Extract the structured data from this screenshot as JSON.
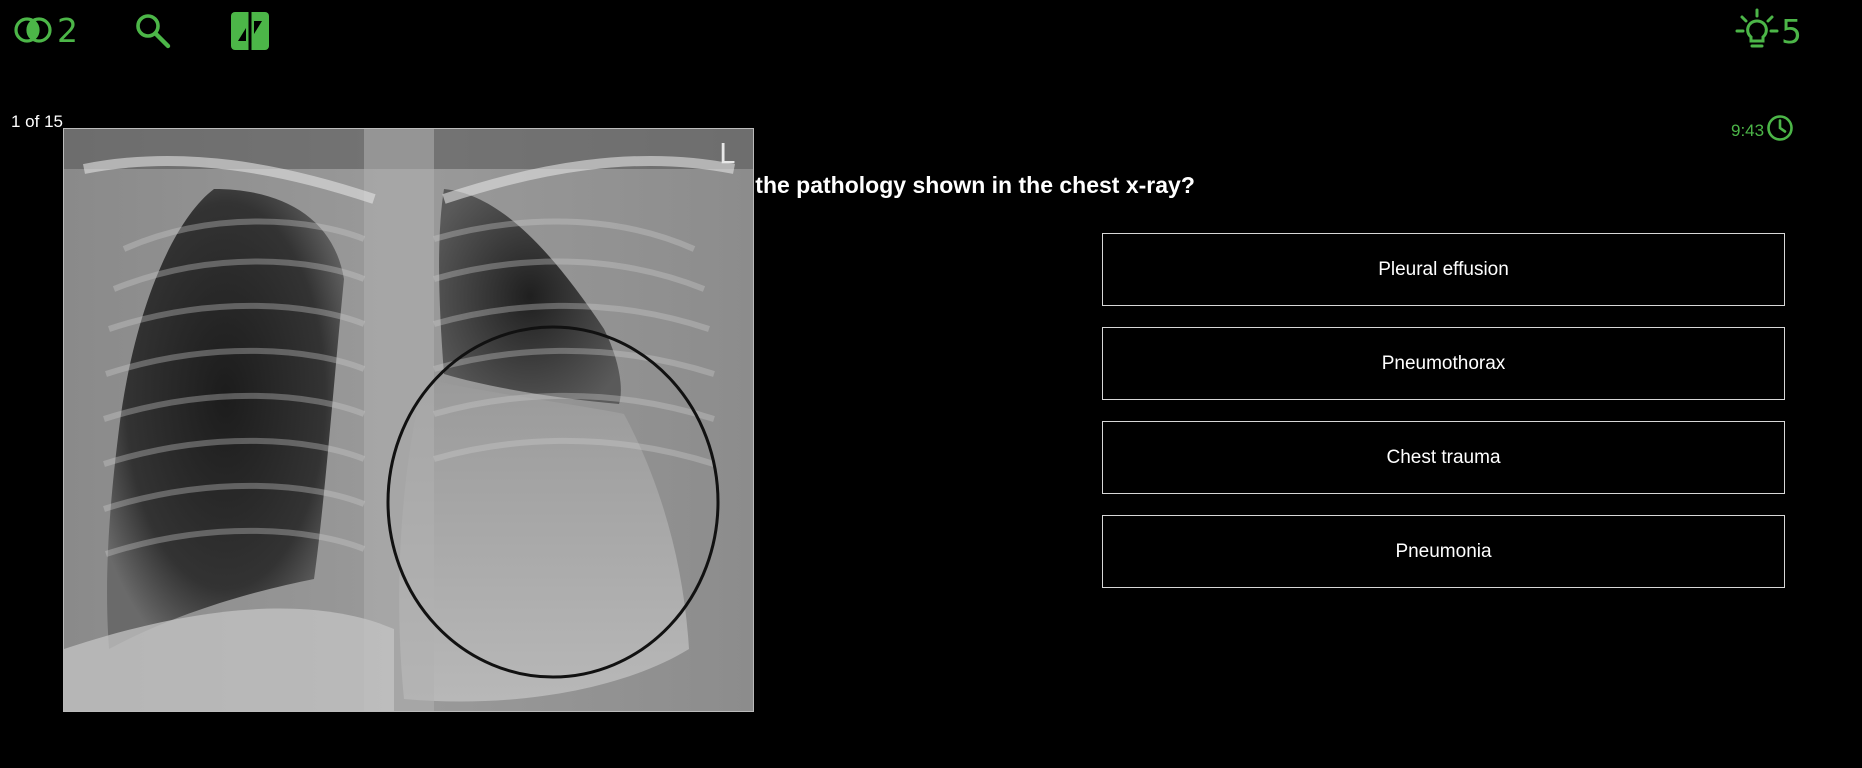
{
  "toolbar": {
    "fifty_fifty_count": "2",
    "hints_count": "5"
  },
  "quiz": {
    "progress": "1 of 15",
    "timer": "9:43",
    "question": "What is the pathology shown in the chest x-ray?",
    "options": [
      {
        "label": "Pleural effusion"
      },
      {
        "label": "Pneumothorax"
      },
      {
        "label": "Chest trauma"
      },
      {
        "label": "Pneumonia"
      }
    ]
  },
  "image": {
    "marker_letter": "L"
  },
  "colors": {
    "accent": "#4cb648",
    "background": "#000000",
    "option_border": "#d7d7d7",
    "text": "#ffffff"
  },
  "icons": [
    "fifty-fifty-icon",
    "search-icon",
    "swap-question-icon",
    "lightbulb-icon",
    "clock-icon"
  ]
}
